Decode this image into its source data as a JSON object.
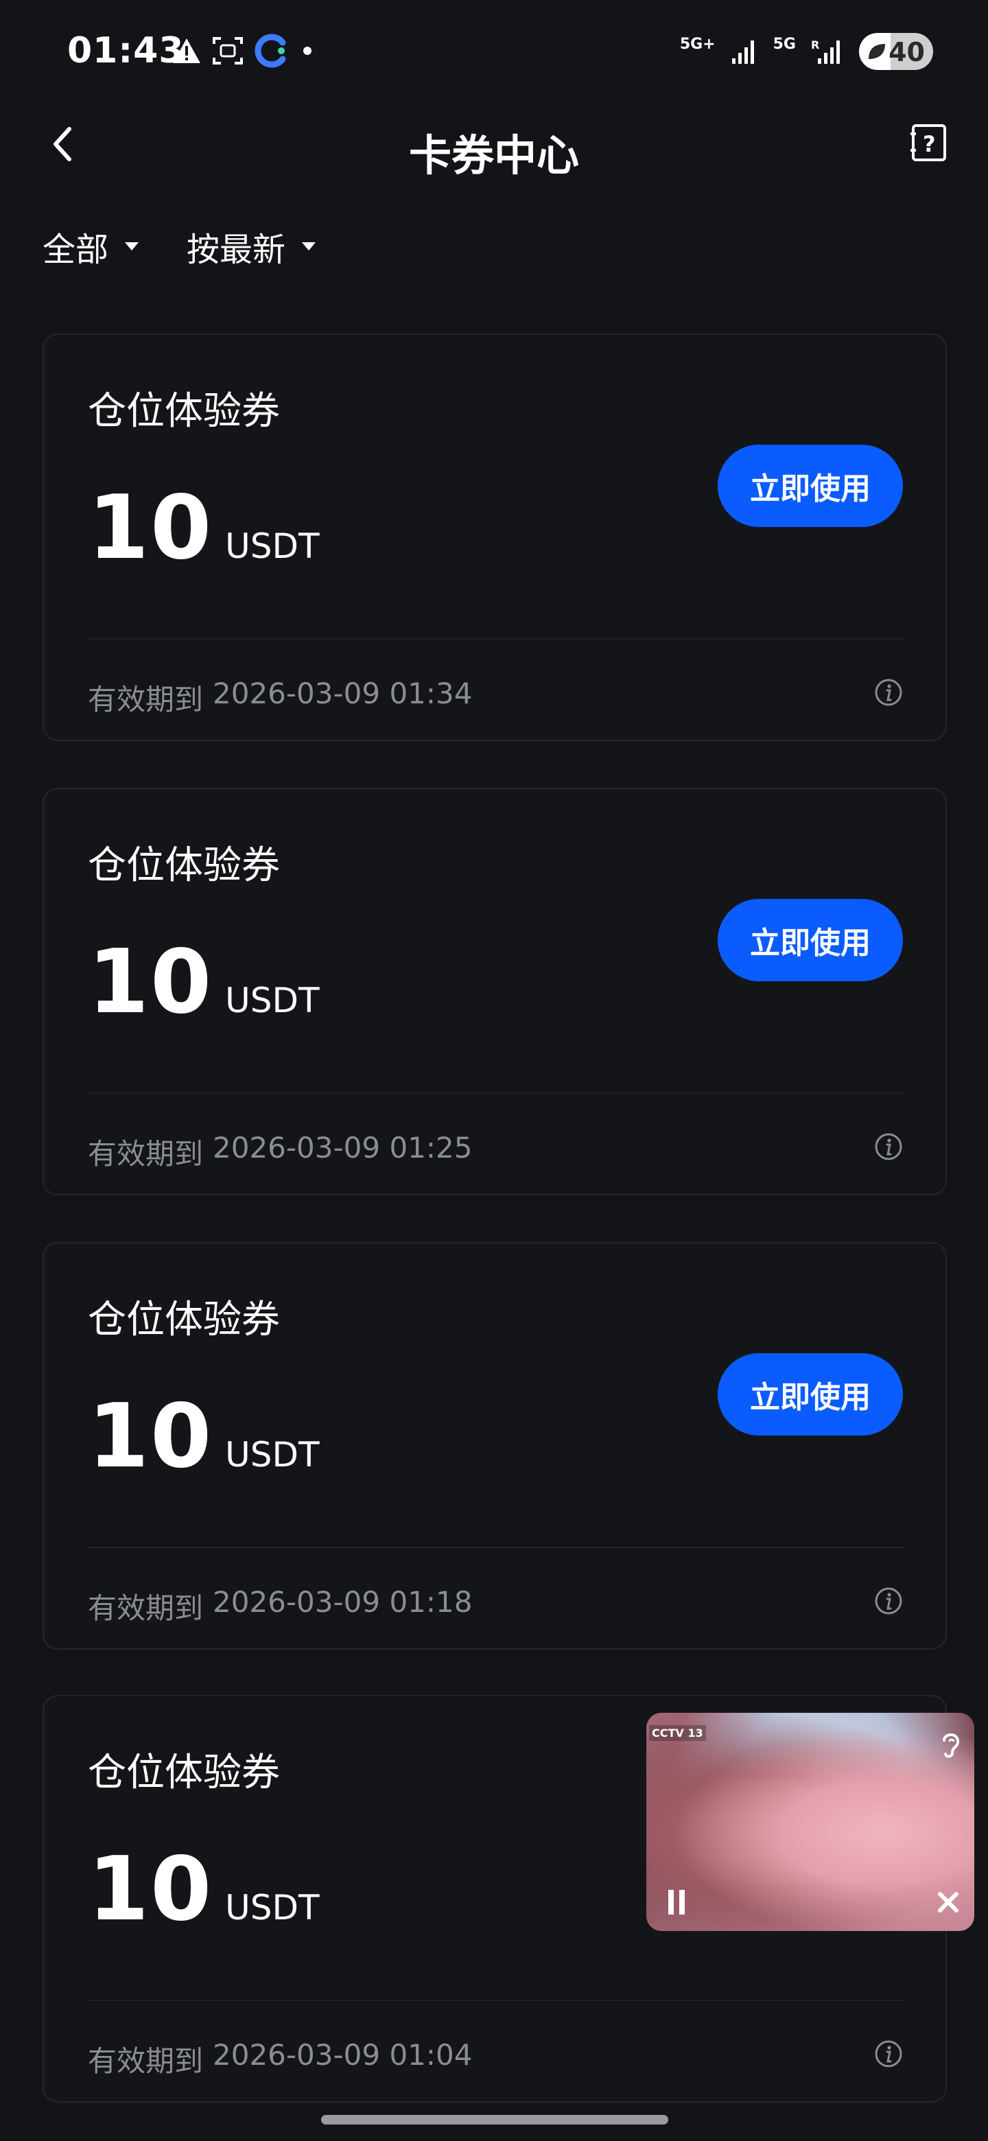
{
  "status_bar": {
    "time": "01:43",
    "network_1": "5G+",
    "network_2": "5G",
    "battery": "40"
  },
  "header": {
    "title": "卡券中心"
  },
  "filters": {
    "category": "全部",
    "sort": "按最新"
  },
  "cards": [
    {
      "title": "仓位体验券",
      "amount": "10",
      "unit": "USDT",
      "button": "立即使用",
      "expiry_label": "有效期到",
      "expiry": "2026-03-09 01:34"
    },
    {
      "title": "仓位体验券",
      "amount": "10",
      "unit": "USDT",
      "button": "立即使用",
      "expiry_label": "有效期到",
      "expiry": "2026-03-09 01:25"
    },
    {
      "title": "仓位体验券",
      "amount": "10",
      "unit": "USDT",
      "button": "立即使用",
      "expiry_label": "有效期到",
      "expiry": "2026-03-09 01:18"
    },
    {
      "title": "仓位体验券",
      "amount": "10",
      "unit": "USDT",
      "expiry_label": "有效期到",
      "expiry": "2026-03-09 01:04"
    }
  ],
  "video_overlay": {
    "channel_logo": "CCTV 13"
  },
  "colors": {
    "background": "#131417",
    "primary_button": "#0a5cff",
    "muted_text": "#8a8d93"
  }
}
